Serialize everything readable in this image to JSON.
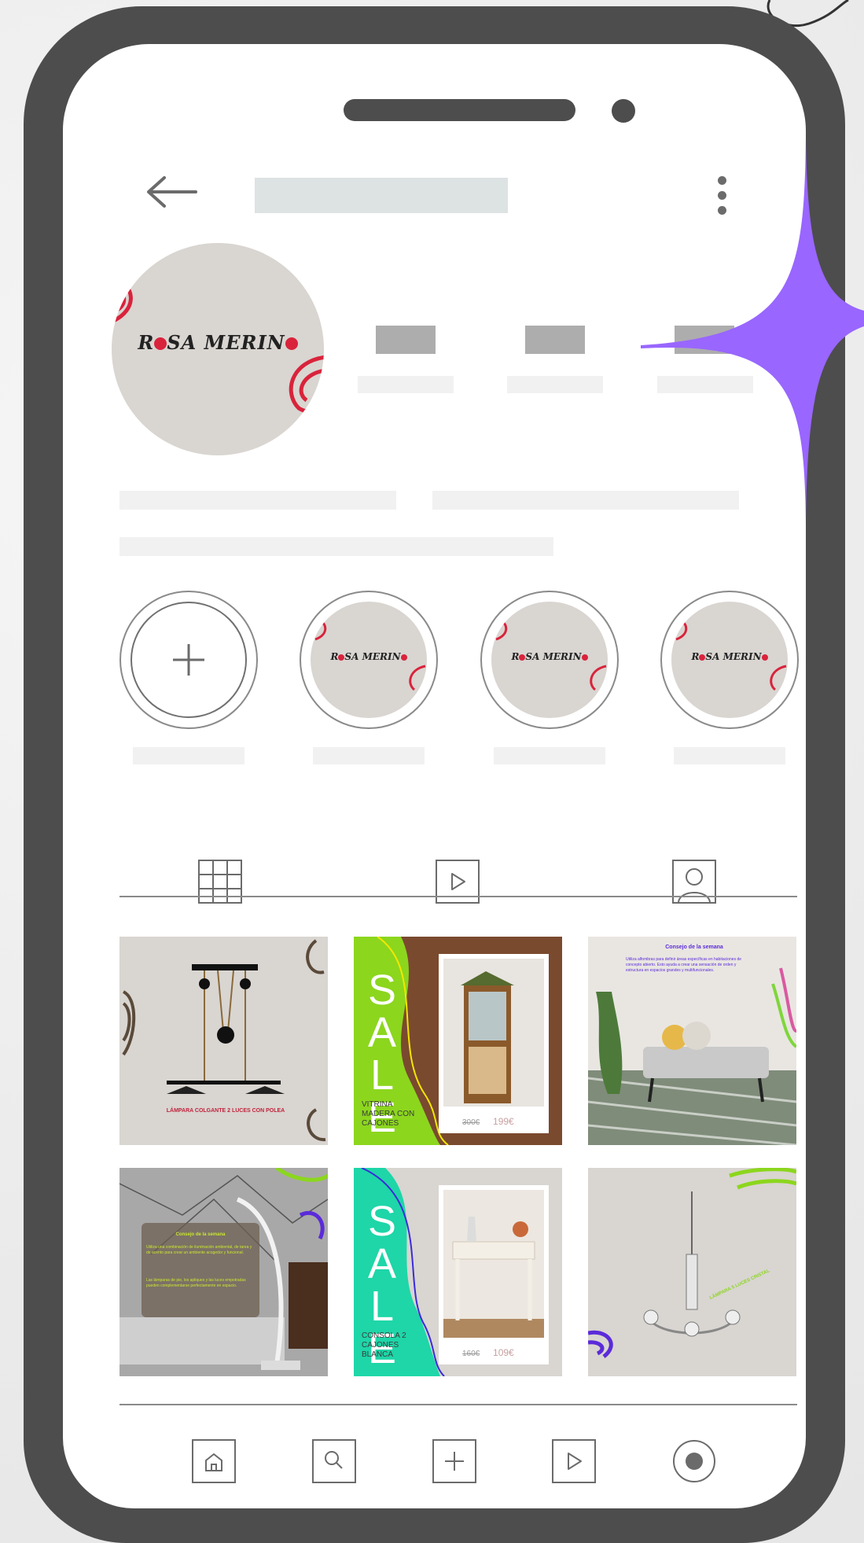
{
  "brand": {
    "logo_text_a": "R",
    "logo_text_b": "SA MERIN",
    "accent_color": "#9966ff",
    "frame_color": "#4d4d4d"
  },
  "icons": {
    "back": "arrow-left-icon",
    "more": "kebab-menu-icon",
    "new_highlight": "plus-icon",
    "grid_tab": "grid-icon",
    "reels_tab": "play-icon",
    "tagged_tab": "person-icon",
    "nav": [
      "home-icon",
      "search-icon",
      "plus-icon",
      "play-icon",
      "profile-icon"
    ]
  },
  "posts": [
    {
      "caption": "LÁMPARA COLGANTE 2 LUCES CON POLEA"
    },
    {
      "sale": "SALE",
      "product": "VITRINA MADERA CON CAJONES",
      "old_price": "300€",
      "price": "199€"
    },
    {
      "title": "Consejo de la semana",
      "body": "Utiliza alfombras para definir áreas específicas en habitaciones de concepto abierto. Esto ayuda a crear una sensación de orden y estructura en espacios grandes y multifuncionales."
    },
    {
      "title": "Consejo de la semana",
      "body_1": "Utiliza una combinación de iluminación ambiental, de tarea y de acento para crear un ambiente acogedor y funcional.",
      "body_2": "Las lámparas de pie, los apliques y las luces empotradas pueden complementarse perfectamente en espacio."
    },
    {
      "sale": "SALE",
      "product": "CONSOLA 2 CAJONES BLANCA",
      "old_price": "160€",
      "price": "109€"
    },
    {
      "caption": "LÁMPARA 5 LUCES CRISTAL"
    }
  ]
}
